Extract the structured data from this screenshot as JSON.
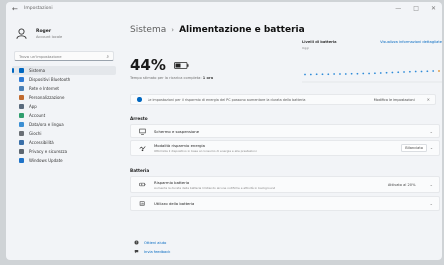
{
  "titlebar": {
    "back": "←",
    "app_title": "Impostazioni",
    "minimize": "—",
    "maximize": "□",
    "close": "✕"
  },
  "user": {
    "name": "Roger",
    "subtitle": "Account locale"
  },
  "search": {
    "placeholder": "Trova un'impostazione"
  },
  "sidebar": {
    "items": [
      {
        "label": "Sistema",
        "color": "#0067c0",
        "active": true
      },
      {
        "label": "Dispositivi Bluetooth",
        "color": "#2e7bd6"
      },
      {
        "label": "Rete e Internet",
        "color": "#4a7fb5"
      },
      {
        "label": "Personalizzazione",
        "color": "#c16b2f"
      },
      {
        "label": "App",
        "color": "#5a6b7d"
      },
      {
        "label": "Account",
        "color": "#2f9e6e"
      },
      {
        "label": "Data/ora e lingua",
        "color": "#3b8fd3"
      },
      {
        "label": "Giochi",
        "color": "#6a6f75"
      },
      {
        "label": "Accessibilità",
        "color": "#3a6fa8"
      },
      {
        "label": "Privacy e sicurezza",
        "color": "#5d6670"
      },
      {
        "label": "Windows Update",
        "color": "#1e73c8"
      }
    ]
  },
  "breadcrumb": {
    "parent": "Sistema",
    "separator": "›",
    "current": "Alimentazione e batteria"
  },
  "battery": {
    "percent": "44%",
    "remaining_label": "Tempo stimato per la ricarica completa:",
    "remaining_value": "1 ora"
  },
  "chart": {
    "title": "Livelli di batteria",
    "link": "Visualizza informazioni dettagliate",
    "subtitle": "Oggi",
    "accent": "#2e8bd8"
  },
  "chart_data": {
    "type": "line",
    "x": [
      0,
      1,
      2,
      3,
      4,
      5,
      6,
      7,
      8,
      9,
      10,
      11,
      12,
      13,
      14,
      15,
      16,
      17,
      18,
      19,
      20,
      21,
      22,
      23
    ],
    "values": [
      30,
      30,
      31,
      31,
      31,
      32,
      32,
      32,
      33,
      33,
      34,
      34,
      35,
      36,
      37,
      38,
      39,
      40,
      41,
      42,
      42,
      43,
      44,
      44
    ],
    "title": "Livelli di batteria",
    "xlabel": "",
    "ylabel": "",
    "ylim": [
      0,
      100
    ]
  },
  "info": {
    "text": "Le impostazioni per il risparmio di energia del PC possono aumentare la durata della batteria",
    "action": "Modifica le impostazioni",
    "close": "✕"
  },
  "sections": {
    "power": "Arresto",
    "battery": "Batteria"
  },
  "cards": {
    "screen": {
      "title": "Schermo e sospensione",
      "desc": ""
    },
    "mode": {
      "title": "Modalità risparmio energia",
      "desc": "Ottimizza il dispositivo in base al consumo di energia e alle prestazioni",
      "value": "Bilanciato"
    },
    "saver": {
      "title": "Risparmio batteria",
      "desc": "Aumenta la durata della batteria limitando alcune notifiche e attività in background",
      "value": "Attivato al 20%"
    },
    "usage": {
      "title": "Utilizzo della batteria",
      "desc": ""
    }
  },
  "footer": {
    "help": "Ottieni aiuto",
    "feedback": "Invia feedback"
  }
}
